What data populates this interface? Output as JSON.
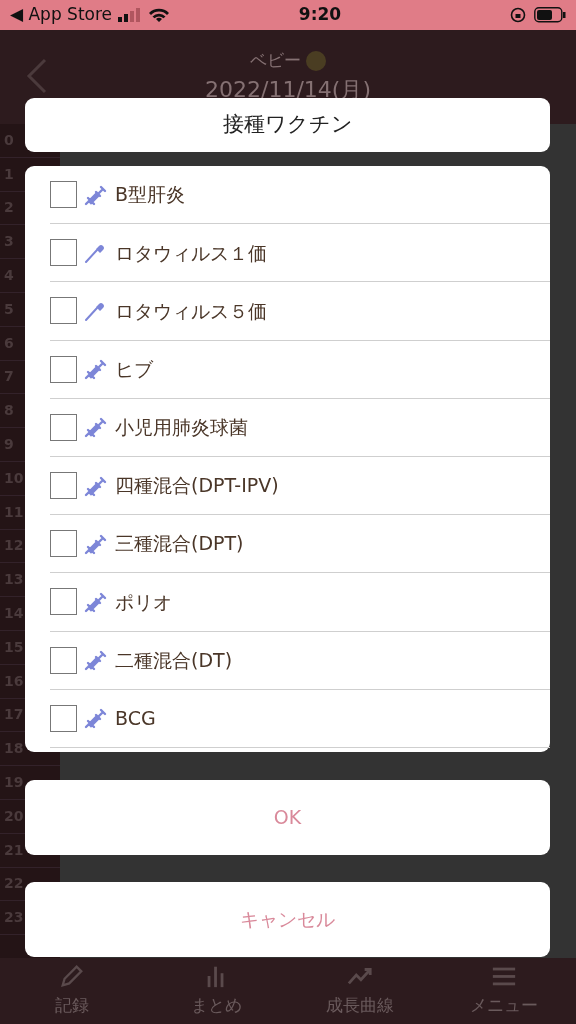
{
  "status_bar": {
    "back_label": "◀ App Store",
    "time": "9:20"
  },
  "header": {
    "title": "ベビー",
    "date": "2022/11/14(月)"
  },
  "hours": [
    "0",
    "1",
    "2",
    "3",
    "4",
    "5",
    "6",
    "7",
    "8",
    "9",
    "10",
    "11",
    "12",
    "13",
    "14",
    "15",
    "16",
    "17",
    "18",
    "19",
    "20",
    "21",
    "22",
    "23"
  ],
  "tab_bar": [
    {
      "label": "記録"
    },
    {
      "label": "まとめ"
    },
    {
      "label": "成長曲線"
    },
    {
      "label": "メニュー"
    }
  ],
  "dialog": {
    "title": "接種ワクチン",
    "items": [
      {
        "label": "B型肝炎",
        "kind": "syringe",
        "checked": false
      },
      {
        "label": "ロタウィルス１価",
        "kind": "dropper",
        "checked": false
      },
      {
        "label": "ロタウィルス５価",
        "kind": "dropper",
        "checked": false
      },
      {
        "label": "ヒブ",
        "kind": "syringe",
        "checked": false
      },
      {
        "label": "小児用肺炎球菌",
        "kind": "syringe",
        "checked": false
      },
      {
        "label": "四種混合(DPT-IPV)",
        "kind": "syringe",
        "checked": false
      },
      {
        "label": "三種混合(DPT)",
        "kind": "syringe",
        "checked": false
      },
      {
        "label": "ポリオ",
        "kind": "syringe",
        "checked": false
      },
      {
        "label": "二種混合(DT)",
        "kind": "syringe",
        "checked": false
      },
      {
        "label": "BCG",
        "kind": "syringe",
        "checked": false
      }
    ],
    "buttons": [
      "OK",
      "キャンセル"
    ]
  }
}
